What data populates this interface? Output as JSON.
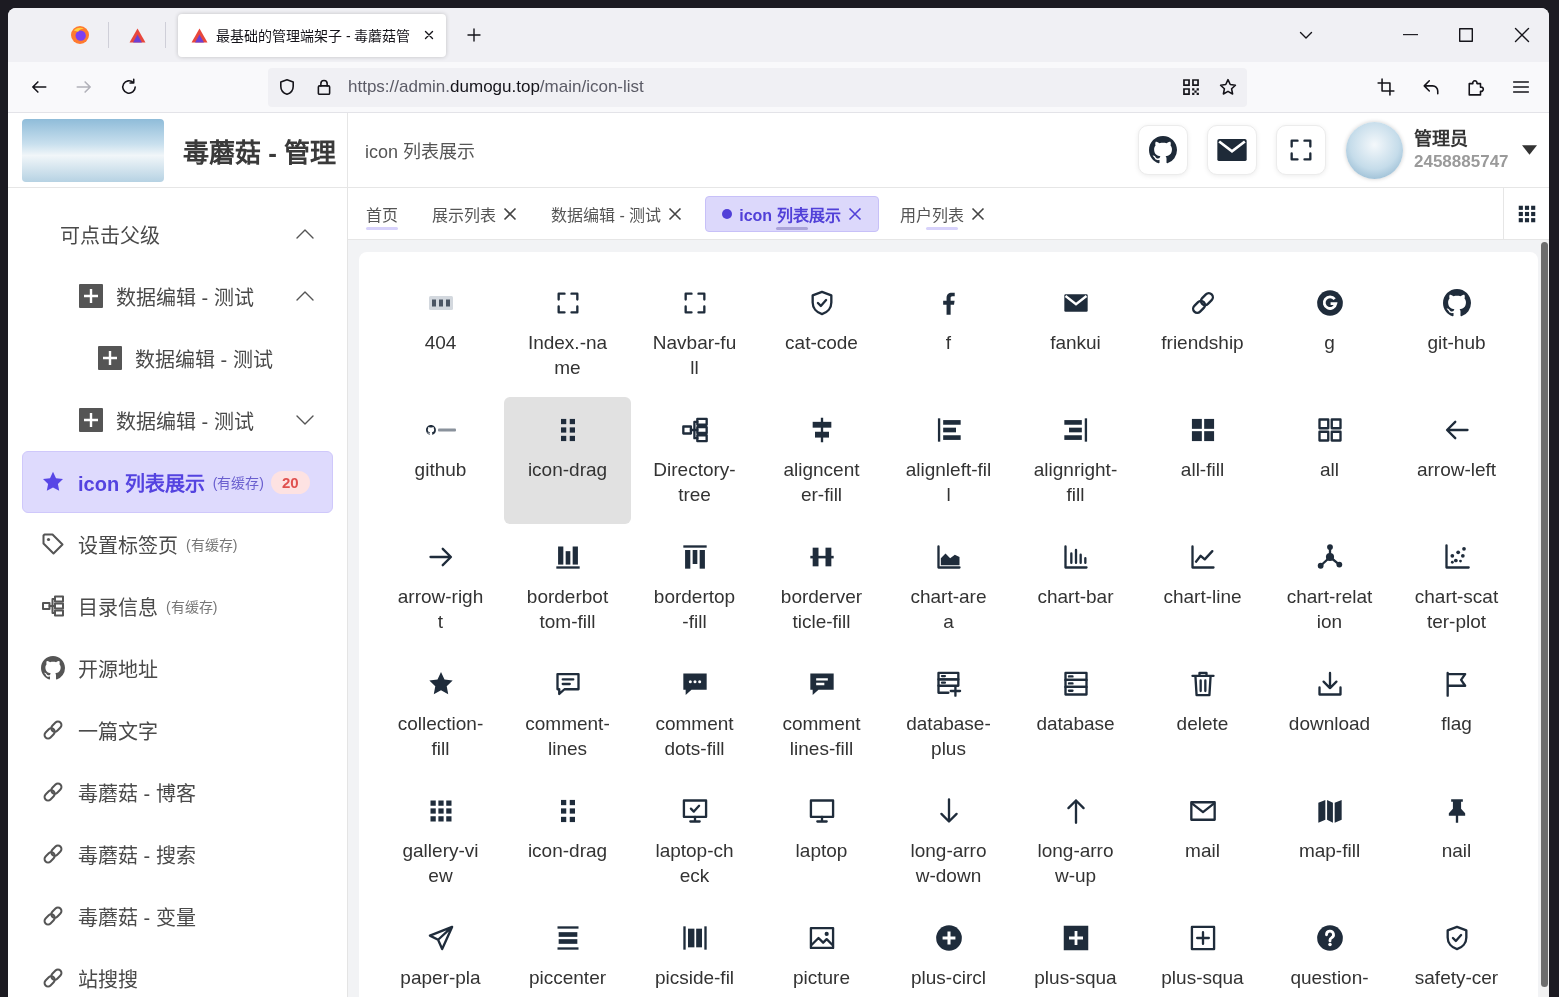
{
  "browser": {
    "tabs": [
      {
        "kind": "pinned",
        "selected": false
      },
      {
        "kind": "pinned",
        "selected": false
      },
      {
        "kind": "page",
        "title": "最基础的管理端架子 - 毒蘑菇管",
        "selected": true
      }
    ],
    "navigation": [
      {
        "disabled": false
      },
      {
        "disabled": true
      },
      {
        "disabled": false
      }
    ],
    "url": "https://admin.**dumogu.top**/main/icon-list"
  },
  "header": {
    "title": "毒蘑菇 - 管理",
    "breadcrumb": "icon 列表展示",
    "user": {
      "name": "管理员",
      "account": "2458885747"
    }
  },
  "sidebar": {
    "items": [
      {
        "label": "可点击父级",
        "expanded": true,
        "selected": false,
        "children": [
          {
            "label": "数据编辑 - 测试",
            "expanded": true,
            "selected": false,
            "children": [
              {
                "label": "数据编辑 - 测试",
                "selected": false
              }
            ]
          },
          {
            "label": "数据编辑 - 测试",
            "expanded": false,
            "selected": false
          }
        ]
      },
      {
        "label": "icon 列表展示",
        "note": "(有缓存)",
        "badge": "20",
        "selected": true
      },
      {
        "label": "设置标签页",
        "note": "(有缓存)",
        "selected": false
      },
      {
        "label": "目录信息",
        "note": "(有缓存)",
        "selected": false
      },
      {
        "label": "开源地址",
        "selected": false
      },
      {
        "label": "一篇文字",
        "selected": false
      },
      {
        "label": "毒蘑菇 - 博客",
        "selected": false
      },
      {
        "label": "毒蘑菇 - 搜索",
        "selected": false
      },
      {
        "label": "毒蘑菇 - 变量",
        "selected": false
      },
      {
        "label": "站搜搜",
        "selected": false
      }
    ]
  },
  "tabs_bar": {
    "tabs": [
      {
        "label": "首页",
        "closable": false,
        "underlined": true,
        "selected": false
      },
      {
        "label": "展示列表",
        "closable": true,
        "underlined": false,
        "selected": false
      },
      {
        "label": "数据编辑 - 测试",
        "closable": true,
        "underlined": false,
        "selected": false
      },
      {
        "label": "icon 列表展示",
        "closable": true,
        "underlined": true,
        "selected": true
      },
      {
        "label": "用户列表",
        "closable": true,
        "underlined": true,
        "selected": false
      }
    ]
  },
  "icon_list": {
    "items": [
      {
        "name": "404",
        "selected": false
      },
      {
        "name": "Index.-name",
        "selected": false
      },
      {
        "name": "Navbar-full",
        "selected": false
      },
      {
        "name": "cat-code",
        "selected": false
      },
      {
        "name": "f",
        "selected": false
      },
      {
        "name": "fankui",
        "selected": false
      },
      {
        "name": "friendship",
        "selected": false
      },
      {
        "name": "g",
        "selected": false
      },
      {
        "name": "git-hub",
        "selected": false
      },
      {
        "name": "github",
        "selected": false
      },
      {
        "name": "icon-drag",
        "selected": true
      },
      {
        "name": "Directory-tree",
        "selected": false
      },
      {
        "name": "aligncenter-fill",
        "selected": false
      },
      {
        "name": "alignleft-fill",
        "selected": false
      },
      {
        "name": "alignright-fill",
        "selected": false
      },
      {
        "name": "all-fill",
        "selected": false
      },
      {
        "name": "all",
        "selected": false
      },
      {
        "name": "arrow-left",
        "selected": false
      },
      {
        "name": "arrow-right",
        "selected": false
      },
      {
        "name": "borderbottom-fill",
        "selected": false
      },
      {
        "name": "bordertop-fill",
        "selected": false
      },
      {
        "name": "borderverticle-fill",
        "selected": false
      },
      {
        "name": "chart-area",
        "selected": false
      },
      {
        "name": "chart-bar",
        "selected": false
      },
      {
        "name": "chart-line",
        "selected": false
      },
      {
        "name": "chart-relation",
        "selected": false
      },
      {
        "name": "chart-scatter-plot",
        "selected": false
      },
      {
        "name": "collection-fill",
        "selected": false
      },
      {
        "name": "comment-lines",
        "selected": false
      },
      {
        "name": "comment dots-fill",
        "selected": false
      },
      {
        "name": "comment lines-fill",
        "selected": false
      },
      {
        "name": "database-plus",
        "selected": false
      },
      {
        "name": "database",
        "selected": false
      },
      {
        "name": "delete",
        "selected": false
      },
      {
        "name": "download",
        "selected": false
      },
      {
        "name": "flag",
        "selected": false
      },
      {
        "name": "gallery-view",
        "selected": false
      },
      {
        "name": "icon-drag",
        "selected": false
      },
      {
        "name": "laptop-check",
        "selected": false
      },
      {
        "name": "laptop",
        "selected": false
      },
      {
        "name": "long-arrow-down",
        "selected": false
      },
      {
        "name": "long-arrow-up",
        "selected": false
      },
      {
        "name": "mail",
        "selected": false
      },
      {
        "name": "map-fill",
        "selected": false
      },
      {
        "name": "nail",
        "selected": false
      },
      {
        "name": "paper-pla",
        "selected": false
      },
      {
        "name": "piccenter",
        "selected": false
      },
      {
        "name": "picside-fil",
        "selected": false
      },
      {
        "name": "picture",
        "selected": false
      },
      {
        "name": "plus-circl",
        "selected": false
      },
      {
        "name": "plus-squa",
        "selected": false
      },
      {
        "name": "plus-squa",
        "selected": false
      },
      {
        "name": "question-",
        "selected": false
      },
      {
        "name": "safety-cer",
        "selected": false
      }
    ]
  }
}
